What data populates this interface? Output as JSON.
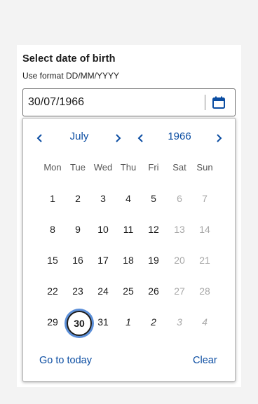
{
  "field": {
    "label": "Select date of birth",
    "hint": "Use format DD/MM/YYYY",
    "value": "30/07/1966"
  },
  "calendar": {
    "month": "July",
    "year": "1966",
    "weekdays": [
      "Mon",
      "Tue",
      "Wed",
      "Thu",
      "Fri",
      "Sat",
      "Sun"
    ],
    "weeks": [
      [
        {
          "d": "1"
        },
        {
          "d": "2"
        },
        {
          "d": "3"
        },
        {
          "d": "4"
        },
        {
          "d": "5"
        },
        {
          "d": "6",
          "weekend": true
        },
        {
          "d": "7",
          "weekend": true
        }
      ],
      [
        {
          "d": "8"
        },
        {
          "d": "9"
        },
        {
          "d": "10"
        },
        {
          "d": "11"
        },
        {
          "d": "12"
        },
        {
          "d": "13",
          "weekend": true
        },
        {
          "d": "14",
          "weekend": true
        }
      ],
      [
        {
          "d": "15"
        },
        {
          "d": "16"
        },
        {
          "d": "17"
        },
        {
          "d": "18"
        },
        {
          "d": "19"
        },
        {
          "d": "20",
          "weekend": true
        },
        {
          "d": "21",
          "weekend": true
        }
      ],
      [
        {
          "d": "22"
        },
        {
          "d": "23"
        },
        {
          "d": "24"
        },
        {
          "d": "25"
        },
        {
          "d": "26"
        },
        {
          "d": "27",
          "weekend": true
        },
        {
          "d": "28",
          "weekend": true
        }
      ],
      [
        {
          "d": "29"
        },
        {
          "d": "30",
          "selected": true
        },
        {
          "d": "31"
        },
        {
          "d": "1",
          "other": true
        },
        {
          "d": "2",
          "other": true
        },
        {
          "d": "3",
          "other": true,
          "weekend": true
        },
        {
          "d": "4",
          "other": true,
          "weekend": true
        }
      ]
    ],
    "go_today_label": "Go to today",
    "clear_label": "Clear"
  },
  "colors": {
    "accent": "#0b4da2",
    "focus_ring": "#5b8fd9",
    "muted": "#a8a8a8"
  },
  "icons": {
    "calendar": "calendar-icon",
    "prev": "chevron-left-icon",
    "next": "chevron-right-icon"
  }
}
